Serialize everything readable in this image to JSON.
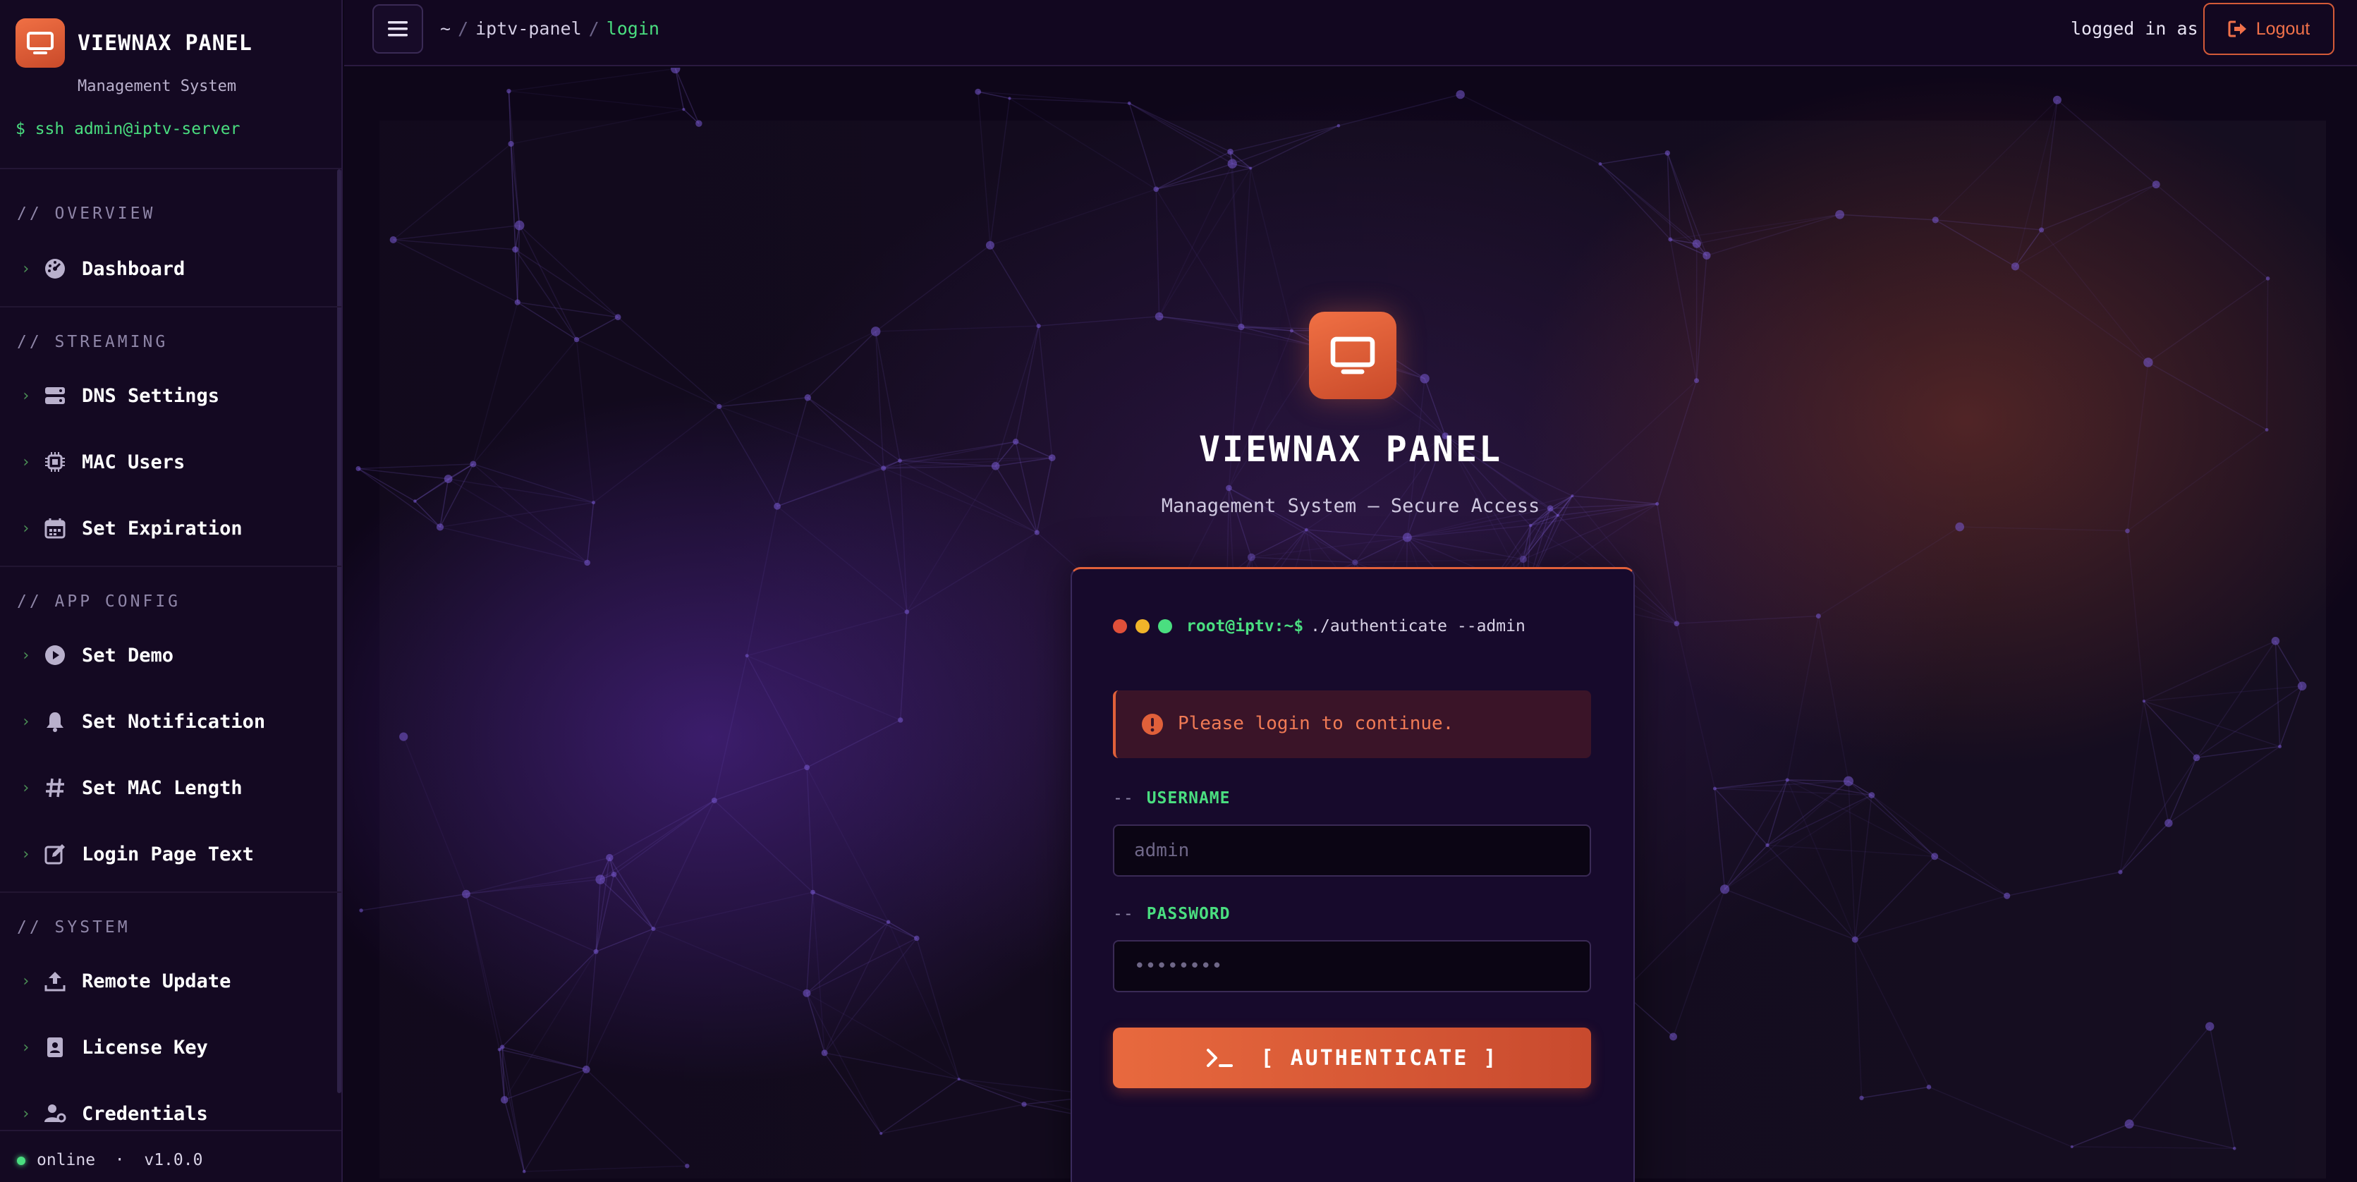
{
  "brand": {
    "title": "VIEWNAX PANEL",
    "subtitle": "Management System",
    "ssh": "$ ssh admin@iptv-server",
    "icon": "monitor-icon"
  },
  "sidebar": {
    "sections": [
      {
        "title": "// OVERVIEW",
        "items": [
          {
            "label": "Dashboard",
            "icon": "gauge-icon"
          }
        ]
      },
      {
        "title": "// STREAMING",
        "items": [
          {
            "label": "DNS Settings",
            "icon": "server-icon"
          },
          {
            "label": "MAC Users",
            "icon": "chip-icon"
          },
          {
            "label": "Set Expiration",
            "icon": "calendar-icon"
          }
        ]
      },
      {
        "title": "// APP CONFIG",
        "items": [
          {
            "label": "Set Demo",
            "icon": "play-circle-icon"
          },
          {
            "label": "Set Notification",
            "icon": "bell-icon"
          },
          {
            "label": "Set MAC Length",
            "icon": "hash-icon"
          },
          {
            "label": "Login Page Text",
            "icon": "edit-icon"
          }
        ]
      },
      {
        "title": "// SYSTEM",
        "items": [
          {
            "label": "Remote Update",
            "icon": "upload-icon"
          },
          {
            "label": "License Key",
            "icon": "id-badge-icon"
          },
          {
            "label": "Credentials",
            "icon": "user-gear-icon"
          }
        ]
      }
    ],
    "footer": {
      "status": "online",
      "separator": "·",
      "version": "v1.0.0"
    }
  },
  "topbar": {
    "breadcrumb": [
      "~",
      "iptv-panel",
      "login"
    ],
    "breadcrumb_sep": "/",
    "logged_in_text": "logged in as",
    "logout_label": "Logout"
  },
  "hero": {
    "title": "VIEWNAX PANEL",
    "subtitle": "Management System — Secure Access"
  },
  "login": {
    "prompt": "root@iptv:~$",
    "command": "./authenticate --admin",
    "alert": "Please login to continue.",
    "label_prefix": "--",
    "username_label": "USERNAME",
    "username_placeholder": "admin",
    "password_label": "PASSWORD",
    "password_placeholder": "••••••••",
    "button_label": "[ AUTHENTICATE ]"
  },
  "colors": {
    "accent": "#e8693e",
    "terminal_green": "#4ade80",
    "background": "#0e0619"
  }
}
